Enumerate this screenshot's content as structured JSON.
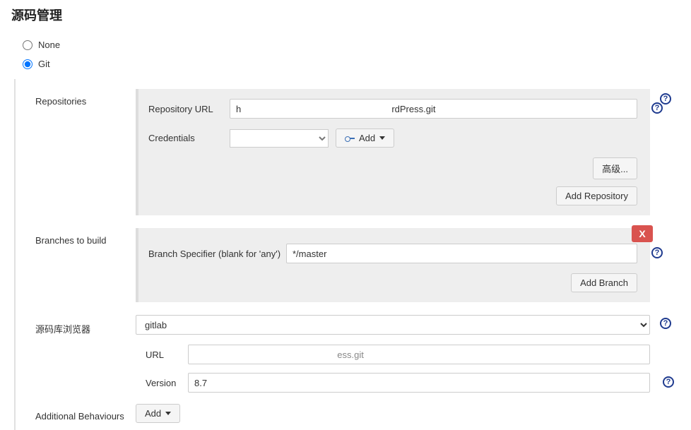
{
  "section_title": "源码管理",
  "scm": {
    "none_label": "None",
    "git_label": "Git"
  },
  "repos": {
    "section_label": "Repositories",
    "url_label": "Repository URL",
    "url_value": "h                                                           rdPress.git",
    "cred_label": "Credentials",
    "cred_value": " ",
    "add_label": "Add",
    "advanced_label": "高级...",
    "add_repo_label": "Add Repository"
  },
  "branches": {
    "section_label": "Branches to build",
    "spec_label": "Branch Specifier (blank for 'any')",
    "spec_value": "*/master",
    "add_branch_label": "Add Branch",
    "delete_label": "X"
  },
  "browser": {
    "section_label": "源码库浏览器",
    "selected": "gitlab",
    "url_label": "URL",
    "url_value": "                                                        ess.git",
    "version_label": "Version",
    "version_value": "8.7"
  },
  "behaviours": {
    "section_label": "Additional Behaviours",
    "add_label": "Add"
  },
  "help_glyph": "?"
}
